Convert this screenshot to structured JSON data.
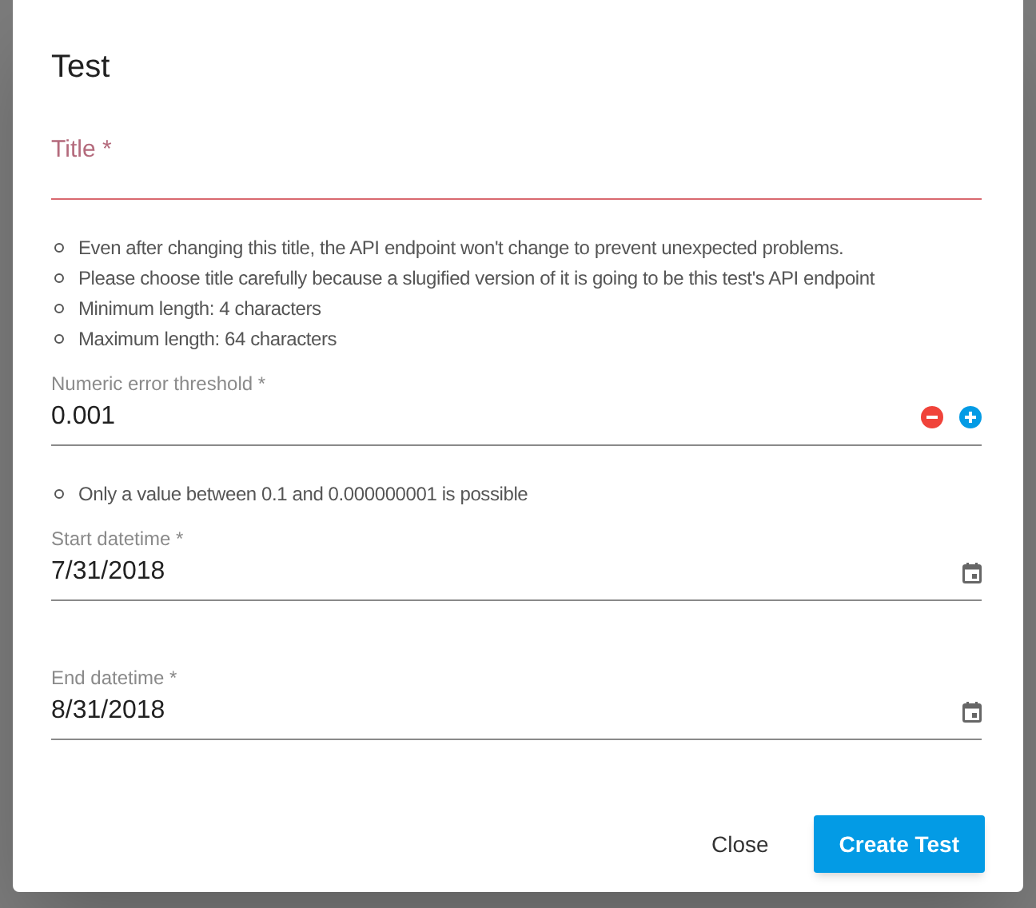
{
  "dialog": {
    "title": "Test"
  },
  "fields": [
    {
      "kind": "text",
      "label": "Title *",
      "error": true,
      "hints": [
        "Even after changing this title, the API endpoint won't change to prevent unexpected problems.",
        "Please choose title carefully because a slugified version of it is going to be this test's API endpoint",
        "Minimum length: 4 characters",
        "Maximum length: 64 characters"
      ]
    },
    {
      "kind": "number",
      "label": "Numeric error threshold *",
      "value": "0.001",
      "error": false,
      "hints": [
        "Only a value between 0.1 and 0.000000001 is possible"
      ]
    },
    {
      "kind": "date",
      "label": "Start datetime *",
      "value": "7/31/2018",
      "error": false
    },
    {
      "kind": "date",
      "label": "End datetime *",
      "value": "8/31/2018",
      "error": false
    }
  ],
  "buttons": [
    {
      "label": "Close",
      "kind": "flat"
    },
    {
      "label": "Create Test",
      "kind": "primary"
    }
  ]
}
